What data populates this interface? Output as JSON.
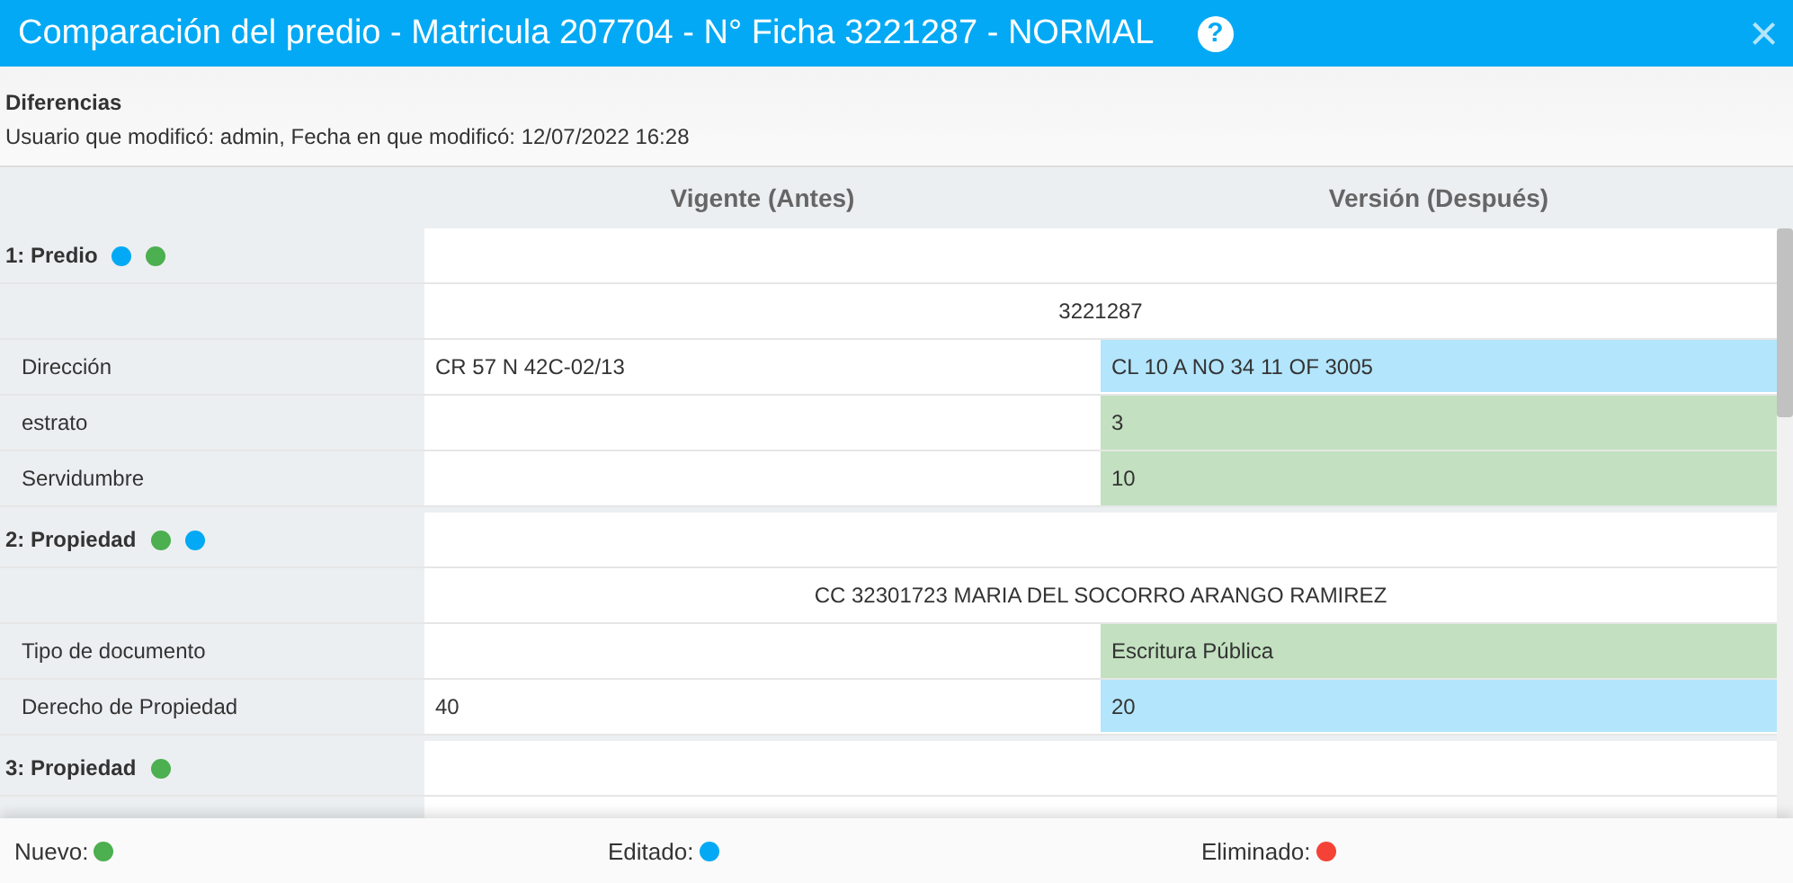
{
  "window": {
    "title": "Comparación del predio - Matricula 207704 - N° Ficha 3221287 - NORMAL",
    "help_icon": "?",
    "close_icon": "×"
  },
  "info": {
    "heading": "Diferencias",
    "subtitle": "Usuario que modificó: admin, Fecha en que modificó: 12/07/2022 16:28"
  },
  "columns": [
    "Vigente (Antes)",
    "Versión (Después)"
  ],
  "groups": [
    {
      "title": "1: Predio",
      "dots": [
        {
          "color": "#03a9f4"
        },
        {
          "color": "#4caf50"
        }
      ],
      "summary": "3221287",
      "fields": [
        {
          "label": "Dirección",
          "before": "CR 57 N 42C-02/13",
          "after": "CL 10 A NO 34 11 OF 3005",
          "kind": "edited"
        },
        {
          "label": "estrato",
          "after": "3",
          "kind": "new"
        },
        {
          "label": "Servidumbre",
          "after": "10",
          "kind": "new"
        }
      ]
    },
    {
      "title": "2: Propiedad",
      "dots": [
        {
          "color": "#4caf50"
        },
        {
          "color": "#03a9f4"
        }
      ],
      "summary": "CC 32301723 MARIA DEL SOCORRO ARANGO RAMIREZ",
      "fields": [
        {
          "label": "Tipo de documento",
          "after": "Escritura Pública",
          "kind": "new"
        },
        {
          "label": "Derecho de Propiedad",
          "before": "40",
          "after": "20",
          "kind": "edited"
        }
      ]
    },
    {
      "title": "3: Propiedad",
      "dots": [
        {
          "color": "#4caf50"
        }
      ]
    }
  ],
  "legend": [
    {
      "label": "Nuevo:",
      "color": "#4caf50"
    },
    {
      "label": "Editado:",
      "color": "#03a9f4"
    },
    {
      "label": "Eliminado:",
      "color": "#f44336"
    }
  ]
}
